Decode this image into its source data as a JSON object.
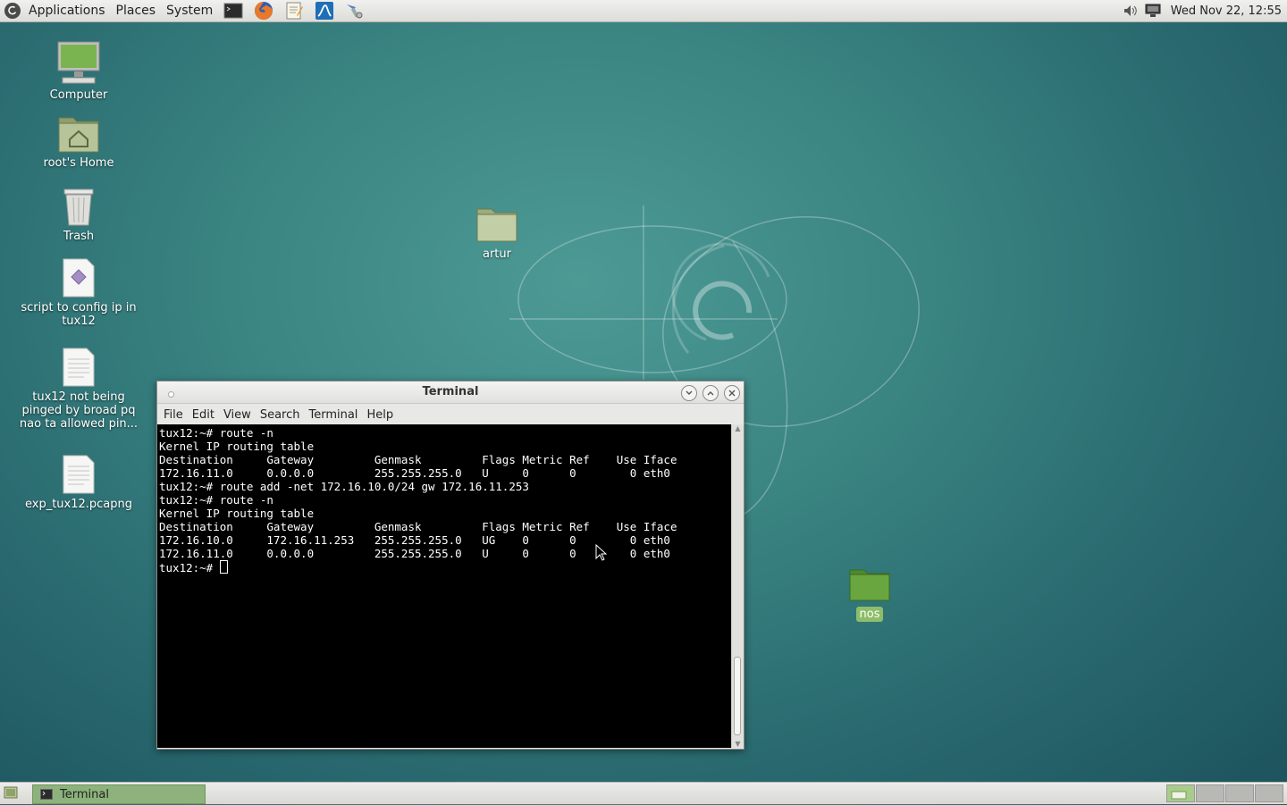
{
  "top_panel": {
    "menus": [
      "Applications",
      "Places",
      "System"
    ],
    "launchers": [
      "terminal-icon",
      "firefox-icon",
      "text-editor-icon",
      "wireshark-icon",
      "network-tool-icon"
    ],
    "clock": "Wed Nov 22, 12:55",
    "tray": [
      "volume-icon",
      "network-icon"
    ]
  },
  "desktop": {
    "icons": [
      {
        "label": "Computer",
        "icon": "computer-icon"
      },
      {
        "label": "root's Home",
        "icon": "home-folder-icon"
      },
      {
        "label": "Trash",
        "icon": "trash-icon"
      },
      {
        "label": "script to config ip in tux12",
        "icon": "script-icon"
      },
      {
        "label": "tux12 not being pinged by broad pq nao ta allowed pin...",
        "icon": "text-file-icon"
      },
      {
        "label": "exp_tux12.pcapng",
        "icon": "text-file-icon"
      },
      {
        "label": "artur",
        "icon": "folder-icon"
      },
      {
        "label": "nos",
        "icon": "folder-icon"
      }
    ]
  },
  "terminal": {
    "title": "Terminal",
    "menu": [
      "File",
      "Edit",
      "View",
      "Search",
      "Terminal",
      "Help"
    ],
    "lines": [
      "tux12:~# route -n",
      "Kernel IP routing table",
      "Destination     Gateway         Genmask         Flags Metric Ref    Use Iface",
      "172.16.11.0     0.0.0.0         255.255.255.0   U     0      0        0 eth0",
      "tux12:~# route add -net 172.16.10.0/24 gw 172.16.11.253",
      "tux12:~# route -n",
      "Kernel IP routing table",
      "Destination     Gateway         Genmask         Flags Metric Ref    Use Iface",
      "172.16.10.0     172.16.11.253   255.255.255.0   UG    0      0        0 eth0",
      "172.16.11.0     0.0.0.0         255.255.255.0   U     0      0        0 eth0"
    ],
    "prompt": "tux12:~# "
  },
  "bottom_panel": {
    "task_label": "Terminal",
    "workspaces": 4,
    "active_workspace": 1
  }
}
